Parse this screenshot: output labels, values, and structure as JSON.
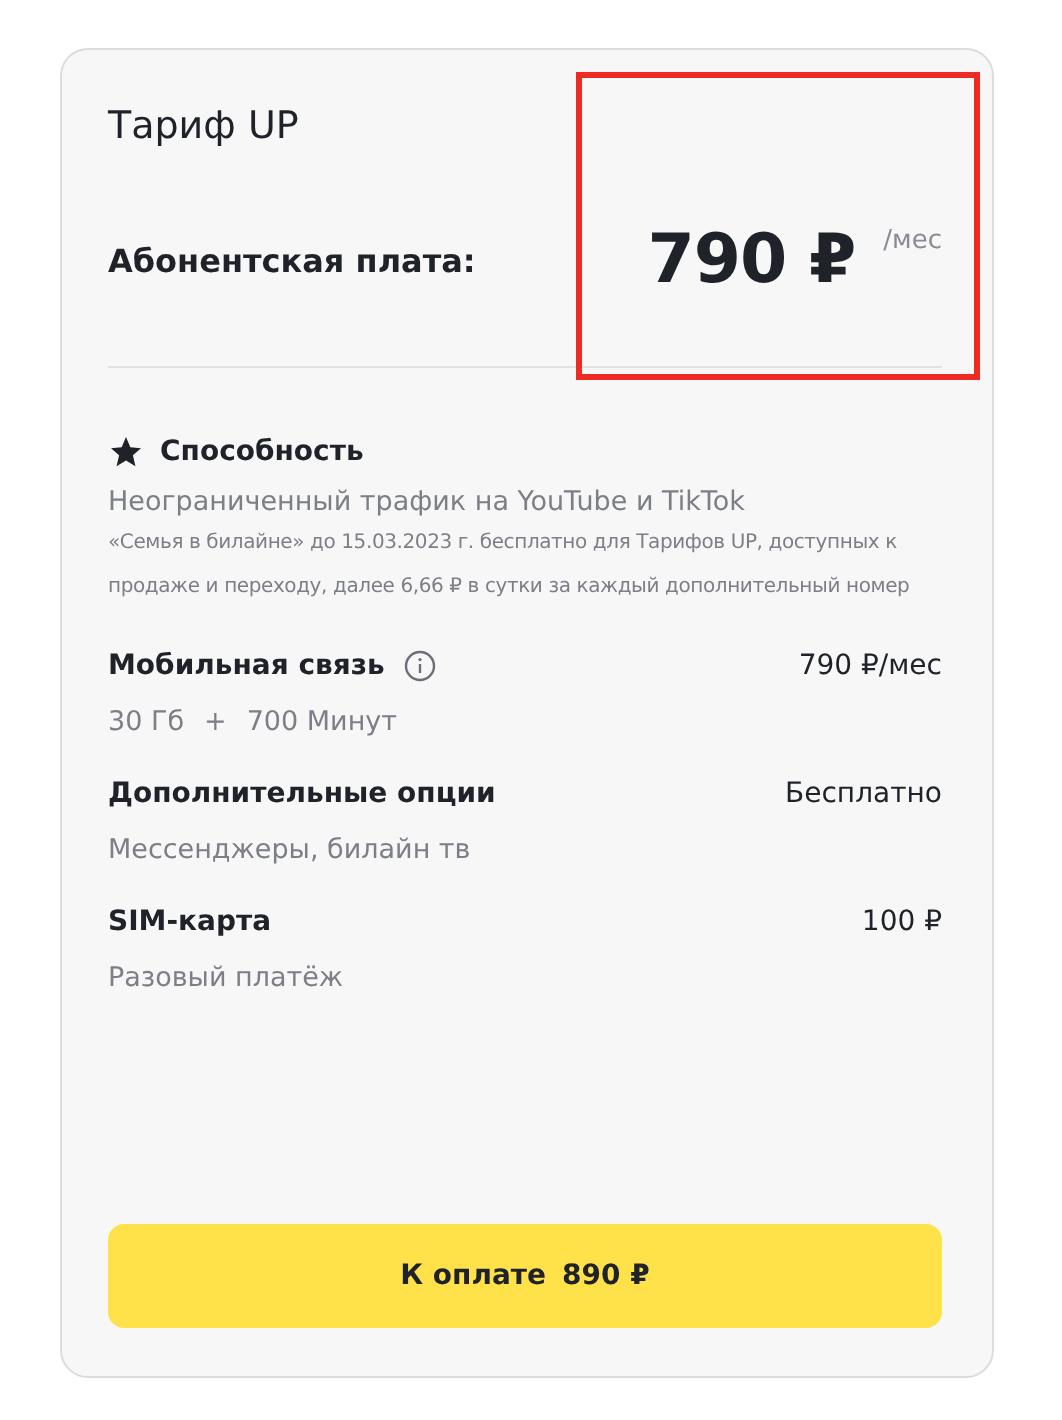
{
  "title": "Тариф UP",
  "fee": {
    "label": "Абонентская плата:",
    "amount": "790 ₽",
    "unit": "/мес"
  },
  "feature": {
    "name": "Способность",
    "headline": "Неограниченный трафик на YouTube и TikTok",
    "note": "«Семья в билайне» до 15.03.2023 г. бесплатно для Тарифов UP, доступных к продаже и переходу, далее 6,66 ₽ в сутки за каждый дополнительный номер"
  },
  "items": [
    {
      "name": "Мобильная связь",
      "info": true,
      "price": "790 ₽/мес",
      "details": [
        "30 Гб",
        "+",
        "700 Минут"
      ]
    },
    {
      "name": "Дополнительные опции",
      "info": false,
      "price": "Бесплатно",
      "details": [
        "Мессенджеры, билайн тв"
      ]
    },
    {
      "name": "SIM-карта",
      "info": false,
      "price": "100 ₽",
      "details": [
        "Разовый платёж"
      ]
    }
  ],
  "pay_button": {
    "label": "К оплате",
    "amount": "890 ₽"
  }
}
